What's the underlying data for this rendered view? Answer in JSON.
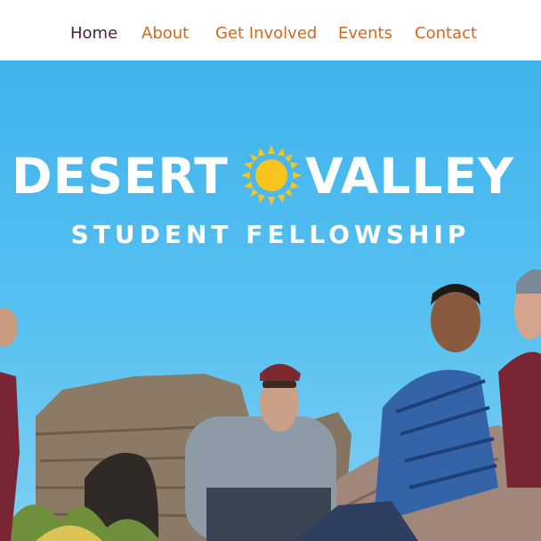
{
  "nav": {
    "items": [
      {
        "label": "Home",
        "active": true
      },
      {
        "label": "About"
      },
      {
        "label": "Get Involved"
      },
      {
        "label": "Events"
      },
      {
        "label": "Contact"
      }
    ]
  },
  "hero": {
    "brand_left": "DESERT",
    "brand_right": "VALLEY",
    "tagline": "STUDENT FELLOWSHIP",
    "sun_icon": "sun-icon",
    "photo_description_icon": "group-photo-image"
  },
  "colors": {
    "nav_active": "#4b1f3c",
    "nav_link": "#d2691e",
    "sky": "#4fbcee",
    "sun": "#f7c51e"
  }
}
